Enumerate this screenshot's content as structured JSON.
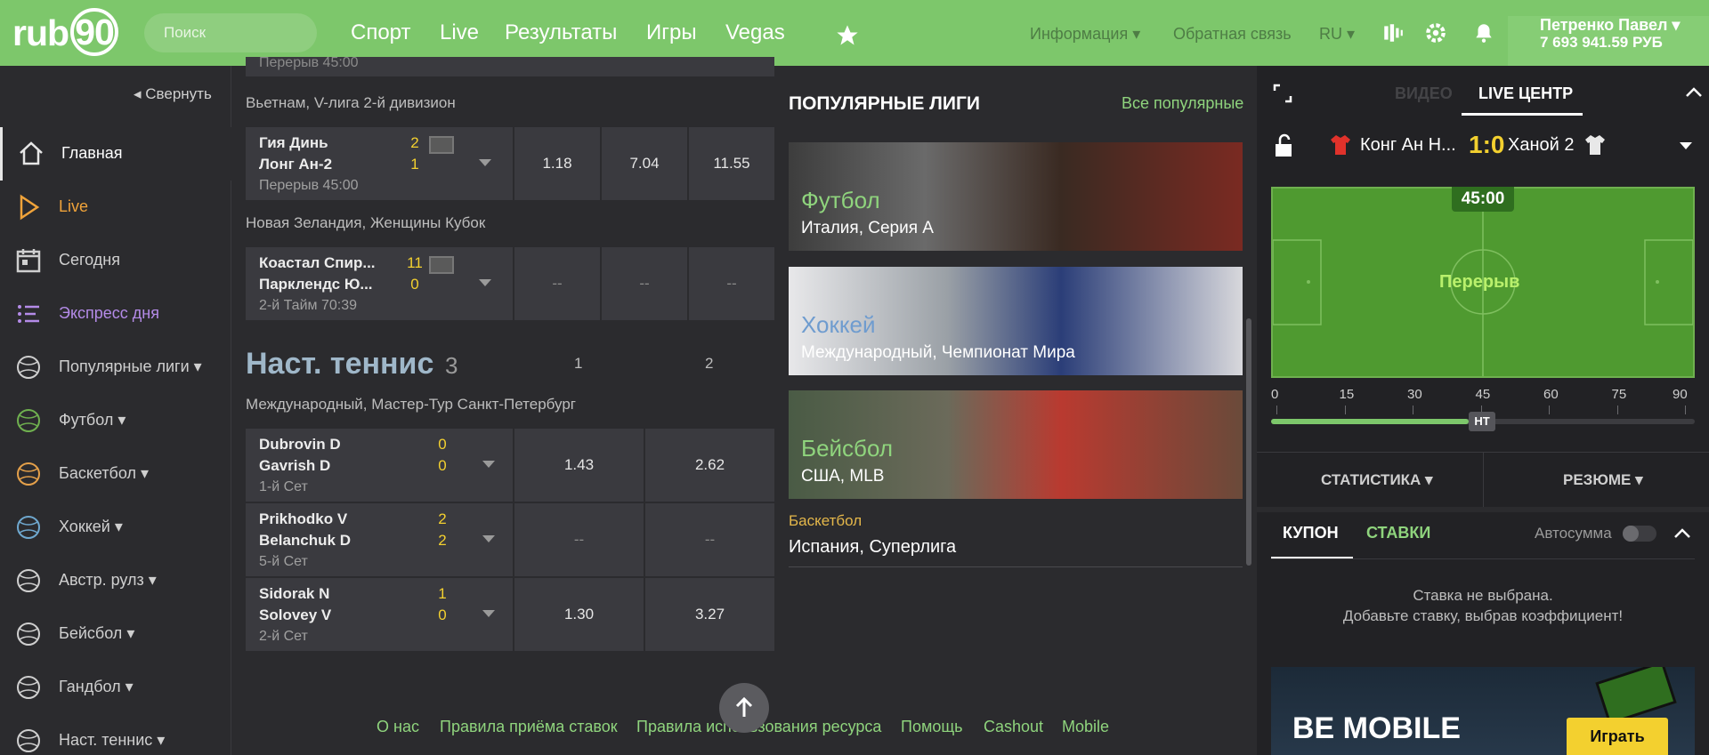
{
  "header": {
    "logo": "rub",
    "logo_num": "90",
    "search_placeholder": "Поиск",
    "nav": [
      "Спорт",
      "Live",
      "Результаты",
      "Игры",
      "Vegas"
    ],
    "info": "Информация",
    "feedback": "Обратная связь",
    "lang": "RU",
    "user_name": "Петренко Павел",
    "balance": "7 693 941.59 РУБ"
  },
  "sidebar": {
    "collapse": "Свернуть",
    "items": [
      {
        "label": "Главная",
        "color": "#ffffff"
      },
      {
        "label": "Live",
        "color": "#f0a33a"
      },
      {
        "label": "Сегодня",
        "color": "#cfcfcf"
      },
      {
        "label": "Экспресс дня",
        "color": "#b48be8"
      },
      {
        "label": "Популярные лиги",
        "color": "#cfcfcf"
      },
      {
        "label": "Футбол",
        "color": "#cfcfcf"
      },
      {
        "label": "Баскетбол",
        "color": "#cfcfcf"
      },
      {
        "label": "Хоккей",
        "color": "#cfcfcf"
      },
      {
        "label": "Австр. рулз",
        "color": "#cfcfcf"
      },
      {
        "label": "Бейсбол",
        "color": "#cfcfcf"
      },
      {
        "label": "Гандбол",
        "color": "#cfcfcf"
      },
      {
        "label": "Наст. теннис",
        "color": "#cfcfcf"
      }
    ]
  },
  "matches": {
    "top_partial_status": "Перерыв 45:00",
    "league1": "Вьетнам, V-лига 2-й дивизион",
    "m1": {
      "t1": "Гия Динь",
      "t2": "Лонг Ан-2",
      "s1": "2",
      "s2": "1",
      "status": "Перерыв 45:00",
      "o1": "1.18",
      "o2": "7.04",
      "o3": "11.55"
    },
    "league2": "Новая Зеландия, Женщины Кубок",
    "m2": {
      "t1": "Коастал Спир...",
      "t2": "Парклендс Ю...",
      "s1": "11",
      "s2": "0",
      "status": "2-й Тайм 70:39",
      "o1": "--",
      "o2": "--",
      "o3": "--"
    },
    "tennis_title": "Наст. теннис",
    "tennis_count": "3",
    "col1": "1",
    "col2": "2",
    "league3": "Международный, Мастер-Тур Санкт-Петербург",
    "t1": {
      "t1": "Dubrovin D",
      "t2": "Gavrish D",
      "s1": "0",
      "s2": "0",
      "status": "1-й Сет",
      "o1": "1.43",
      "o2": "2.62"
    },
    "t2": {
      "t1": "Prikhodko V",
      "t2": "Belanchuk D",
      "s1": "2",
      "s2": "2",
      "status": "5-й Сет",
      "o1": "--",
      "o2": "--"
    },
    "t3": {
      "t1": "Sidorak N",
      "t2": "Solovey V",
      "s1": "1",
      "s2": "0",
      "status": "2-й Сет",
      "o1": "1.30",
      "o2": "3.27"
    }
  },
  "popular": {
    "title": "ПОПУЛЯРНЫЕ ЛИГИ",
    "all": "Все популярные",
    "cards": [
      {
        "sport": "Футбол",
        "league": "Италия, Серия А"
      },
      {
        "sport": "Хоккей",
        "league": "Международный, Чемпионат Мира"
      },
      {
        "sport": "Бейсбол",
        "league": "США, MLB"
      }
    ],
    "extra_sport": "Баскетбол",
    "extra_league": "Испания, Суперлига"
  },
  "footer": [
    "О нас",
    "Правила приёма ставок",
    "Правила использования ресурса",
    "Помощь",
    "Cashout",
    "Mobile"
  ],
  "live": {
    "tab_video": "ВИДЕО",
    "tab_center": "LIVE ЦЕНТР",
    "home": "Конг Ан Н...",
    "score": "1:0",
    "away": "Ханой 2",
    "time": "45:00",
    "status": "Перерыв",
    "ticks": [
      "0",
      "15",
      "30",
      "45",
      "60",
      "75",
      "90"
    ],
    "progress_minute": 45,
    "ht": "HT",
    "stats": "СТАТИСТИКА",
    "summary": "РЕЗЮМЕ"
  },
  "coupon": {
    "tab1": "КУПОН",
    "tab2": "СТАВКИ",
    "auto": "Автосумма",
    "empty1": "Ставка не выбрана.",
    "empty2": "Добавьте ставку, выбрав коэффициент!",
    "banner": "BE MOBILE",
    "play": "Играть"
  }
}
